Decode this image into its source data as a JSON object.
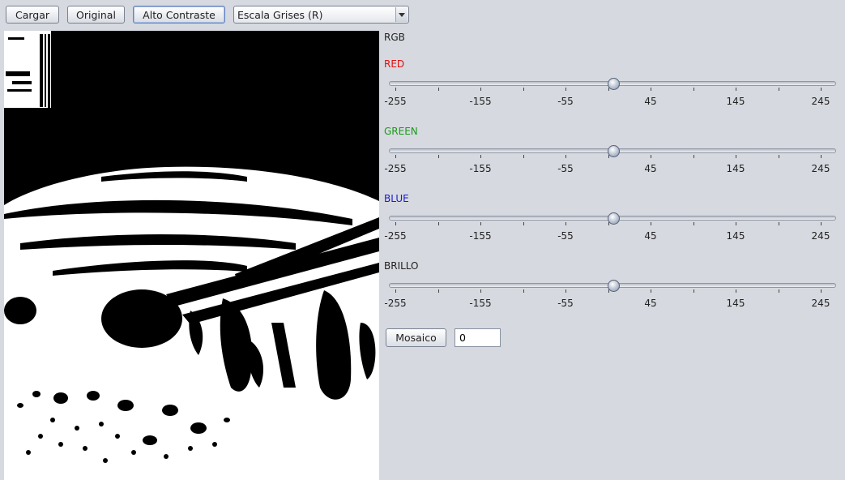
{
  "toolbar": {
    "load_label": "Cargar",
    "original_label": "Original",
    "high_contrast_label": "Alto Contraste",
    "filter_selected": "Escala Grises (R)"
  },
  "panel": {
    "rgb_label": "RGB",
    "sliders": [
      {
        "key": "red",
        "label": "RED",
        "color": "#e01010",
        "value": 0
      },
      {
        "key": "green",
        "label": "GREEN",
        "color": "#1a9a1a",
        "value": 0
      },
      {
        "key": "blue",
        "label": "BLUE",
        "color": "#1a1ad8",
        "value": 0
      },
      {
        "key": "brightness",
        "label": "BRILLO",
        "color": "#222222",
        "value": 0
      }
    ],
    "min": -255,
    "max": 255,
    "major_ticks": [
      "-255",
      "-155",
      "-55",
      "45",
      "145",
      "245"
    ],
    "mosaic_label": "Mosaico",
    "mosaic_value": "0"
  }
}
